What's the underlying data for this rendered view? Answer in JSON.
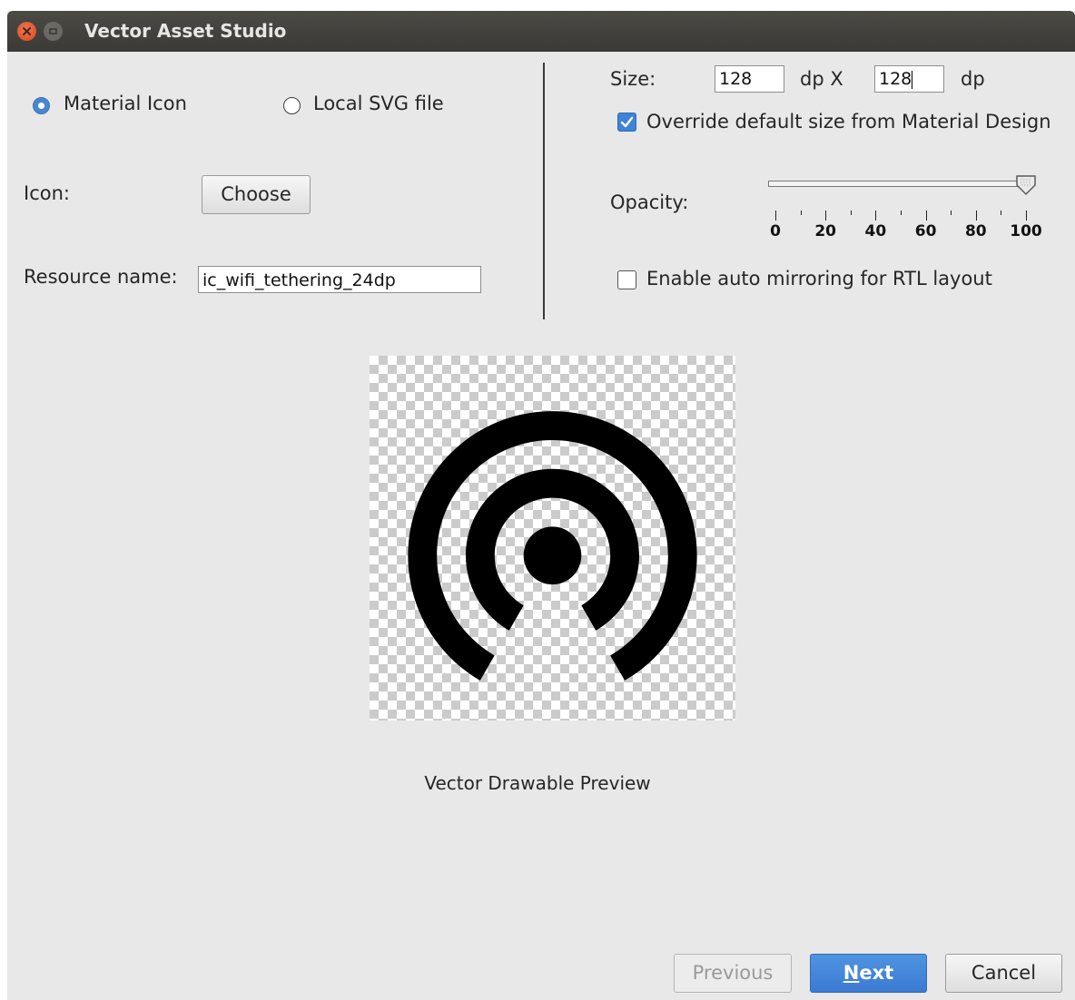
{
  "window": {
    "title": "Vector Asset Studio"
  },
  "left": {
    "radio_material": "Material Icon",
    "radio_local": "Local SVG file",
    "icon_label": "Icon:",
    "choose_button": "Choose",
    "resource_label": "Resource name:",
    "resource_value": "ic_wifi_tethering_24dp"
  },
  "right": {
    "size_label": "Size:",
    "width_value": "128",
    "unit_x": "dp X",
    "height_value": "128",
    "unit": "dp",
    "override_label": "Override default size from Material Design",
    "override_checked": true,
    "opacity_label": "Opacity:",
    "opacity_value": 100,
    "opacity_ticks": [
      "0",
      "20",
      "40",
      "60",
      "80",
      "100"
    ],
    "mirroring_label": "Enable auto mirroring for RTL layout",
    "mirroring_checked": false
  },
  "preview": {
    "caption": "Vector Drawable Preview",
    "icon": "wifi-tethering-icon"
  },
  "footer": {
    "previous": "Previous",
    "next": "Next",
    "cancel": "Cancel"
  },
  "colors": {
    "accent": "#3f82d8",
    "titlebar": "#3b3a36",
    "close": "#e05a2b"
  }
}
